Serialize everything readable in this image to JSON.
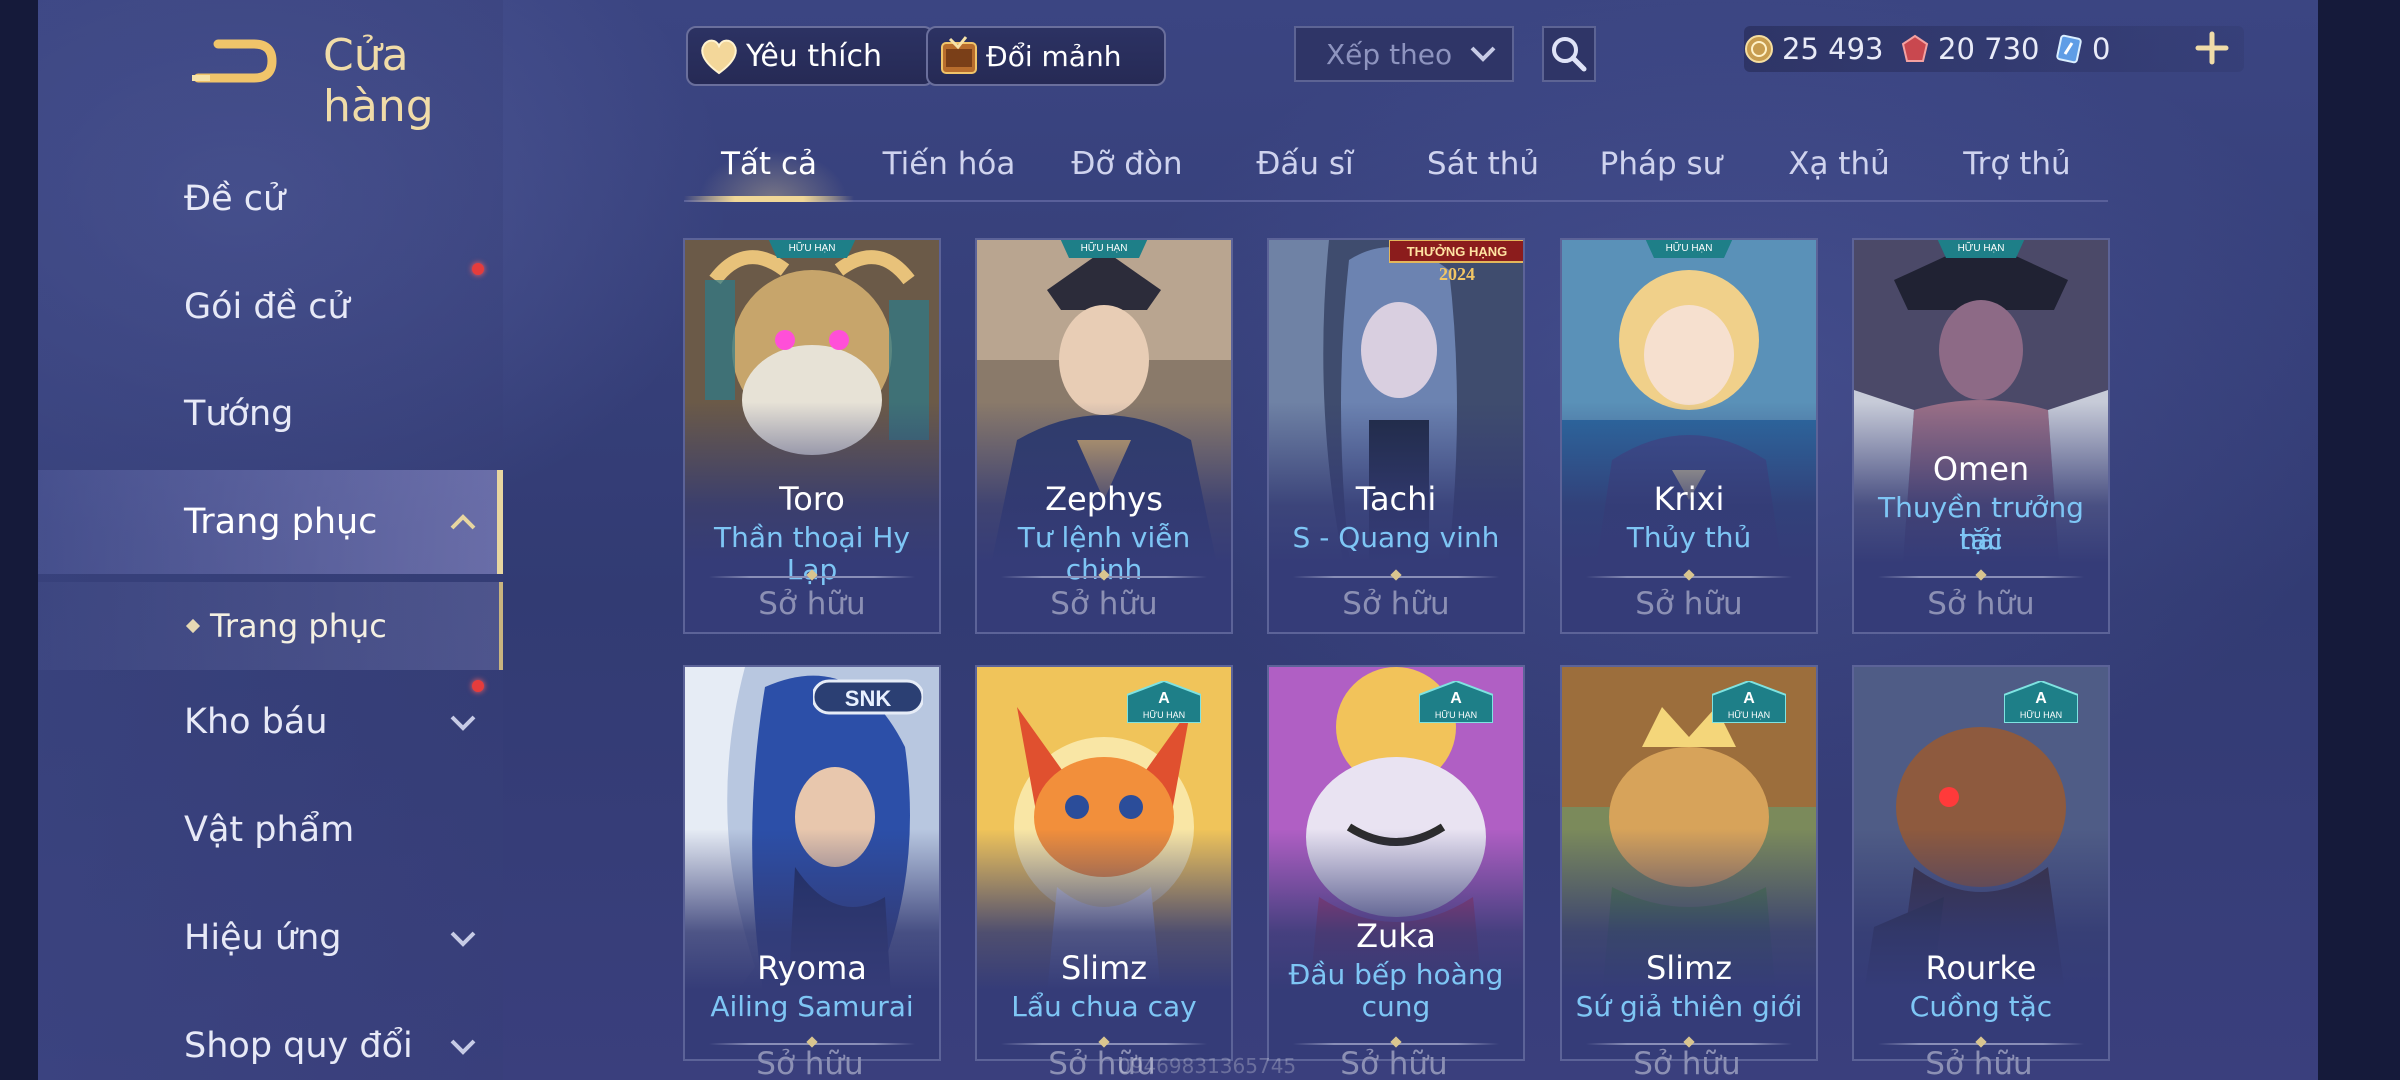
{
  "header": {
    "title": "Cửa hàng",
    "favorite_label": "Yêu thích",
    "exchange_label": "Đổi mảnh",
    "sort_placeholder": "Xếp theo"
  },
  "currency": {
    "gold": "25 493",
    "vouchers": "20 730",
    "tokens": "0"
  },
  "sidebar": {
    "items": [
      {
        "label": "Đề cử"
      },
      {
        "label": "Gói đề cử"
      },
      {
        "label": "Tướng"
      },
      {
        "label": "Trang phục"
      },
      {
        "label": "Kho báu"
      },
      {
        "label": "Vật phẩm"
      },
      {
        "label": "Hiệu ứng"
      },
      {
        "label": "Shop quy đổi"
      }
    ],
    "sub_item": "Trang phục"
  },
  "tabs": [
    "Tất cả",
    "Tiến hóa",
    "Đỡ đòn",
    "Đấu sĩ",
    "Sát thủ",
    "Pháp sư",
    "Xạ thủ",
    "Trợ thủ"
  ],
  "cards": [
    {
      "hero": "Toro",
      "skin": "Thần thoại Hy Lạp",
      "status": "Sở hữu",
      "badge": "HỮU HẠN"
    },
    {
      "hero": "Zephys",
      "skin": "Tư lệnh viễn chinh",
      "status": "Sở hữu",
      "badge": "HỮU HẠN"
    },
    {
      "hero": "Tachi",
      "skin": "S - Quang vinh",
      "status": "Sở hữu",
      "event": "THƯỞNG HẠNG",
      "event_year": "2024"
    },
    {
      "hero": "Krixi",
      "skin": "Thủy thủ",
      "status": "Sở hữu",
      "badge": "HỮU HẠN"
    },
    {
      "hero": "Omen",
      "skin_line1": "Thuyền trưởng hải",
      "skin_line2": "tặc",
      "status": "Sở hữu",
      "badge": "HỮU HẠN"
    },
    {
      "hero": "Ryoma",
      "skin": "Ailing Samurai",
      "status": "Sở hữu",
      "brand": "SNK"
    },
    {
      "hero": "Slimz",
      "skin": "Lẩu chua cay",
      "status": "Sở hữu",
      "badge_rank": "A",
      "badge": "HỮU HẠN"
    },
    {
      "hero": "Zuka",
      "skin_line1": "Đầu bếp hoàng",
      "skin_line2": "cung",
      "status": "Sở hữu",
      "badge_rank": "A",
      "badge": "HỮU HẠN"
    },
    {
      "hero": "Slimz",
      "skin": "Sứ giả thiên giới",
      "status": "Sở hữu",
      "badge_rank": "A",
      "badge": "HỮU HẠN"
    },
    {
      "hero": "Rourke",
      "skin": "Cuồng tặc",
      "status": "Sở hữu",
      "badge_rank": "A",
      "badge": "HỮU HẠN"
    }
  ],
  "watermark": "09469831365745",
  "colors": {
    "accent_gold": "#f0dca8",
    "skin_blue": "#7ec6f5",
    "notification_red": "#e53c3c"
  }
}
